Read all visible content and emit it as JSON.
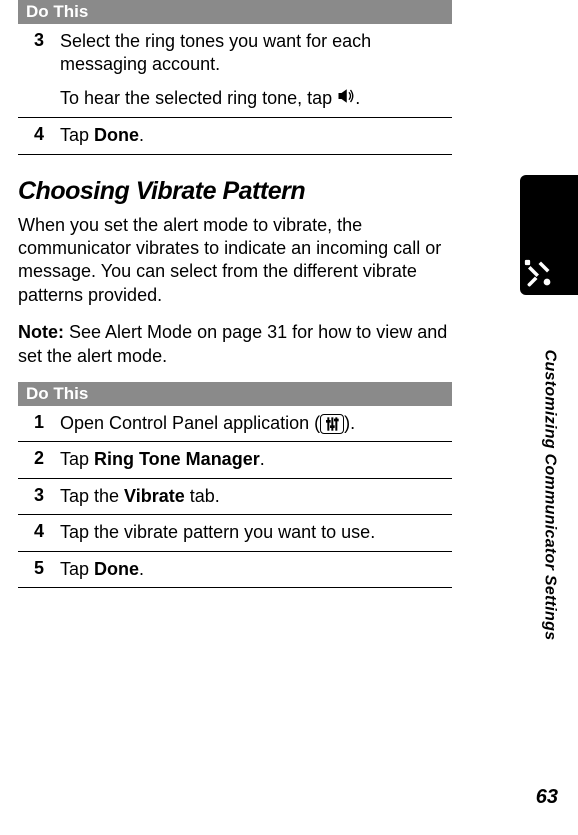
{
  "topTable": {
    "header": "Do This",
    "rows": [
      {
        "num": "3",
        "text": "Select the ring tones you want for each messaging account.",
        "sub_pre": "To hear the selected ring tone, tap ",
        "sub_post": "."
      },
      {
        "num": "4",
        "text_pre": "Tap ",
        "bold": "Done",
        "text_post": "."
      }
    ]
  },
  "section": {
    "title": "Choosing Vibrate Pattern",
    "para1": "When you set the alert mode to vibrate, the communicator vibrates to indicate an incoming call or message. You can select from the different vibrate patterns provided.",
    "note_label": "Note:",
    "note_text": " See Alert Mode on page 31 for how to view and set the alert mode."
  },
  "bottomTable": {
    "header": "Do This",
    "rows": [
      {
        "num": "1",
        "text_pre": "Open Control Panel application (",
        "text_post": ")."
      },
      {
        "num": "2",
        "text_pre": "Tap ",
        "bold": "Ring Tone Manager",
        "text_post": "."
      },
      {
        "num": "3",
        "text_pre": "Tap the ",
        "bold": "Vibrate",
        "text_post": " tab."
      },
      {
        "num": "4",
        "text": "Tap the vibrate pattern you want to use."
      },
      {
        "num": "5",
        "text_pre": "Tap ",
        "bold": "Done",
        "text_post": "."
      }
    ]
  },
  "sideTab": "Customizing Communicator Settings",
  "pageNumber": "63"
}
